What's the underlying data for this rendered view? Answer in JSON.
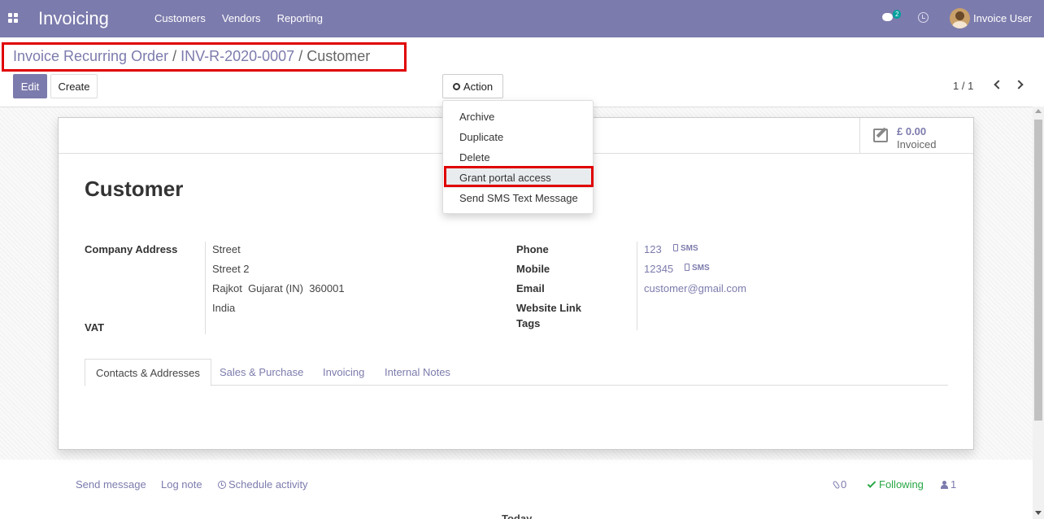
{
  "navbar": {
    "app_title": "Invoicing",
    "menu": [
      "Customers",
      "Vendors",
      "Reporting"
    ],
    "chat_badge": "2",
    "user_name": "Invoice User",
    "bg_color": "#7c7bad"
  },
  "breadcrumb": {
    "items": [
      "Invoice Recurring Order",
      "INV-R-2020-0007"
    ],
    "current": "Customer",
    "separator": "/"
  },
  "toolbar": {
    "edit_label": "Edit",
    "create_label": "Create",
    "action_label": "Action",
    "pager": "1 / 1"
  },
  "action_menu": {
    "items": [
      "Archive",
      "Duplicate",
      "Delete",
      "Grant portal access",
      "Send SMS Text Message"
    ],
    "highlighted": "Grant portal access"
  },
  "stat_button": {
    "value": "£ 0.00",
    "label": "Invoiced"
  },
  "record": {
    "name": "Customer",
    "company_address_label": "Company Address",
    "address_lines": [
      "Street",
      "Street 2",
      "Rajkot  Gujarat (IN)  360001",
      "India"
    ],
    "vat_label": "VAT",
    "phone_label": "Phone",
    "phone": "123",
    "mobile_label": "Mobile",
    "mobile": "12345",
    "sms_label": "SMS",
    "email_label": "Email",
    "email": "customer@gmail.com",
    "website_label": "Website Link",
    "tags_label": "Tags"
  },
  "tabs": [
    "Contacts & Addresses",
    "Sales & Purchase",
    "Invoicing",
    "Internal Notes"
  ],
  "chatter": {
    "send_message": "Send message",
    "log_note": "Log note",
    "schedule_activity": "Schedule activity",
    "attachments": "0",
    "following": "Following",
    "followers": "1",
    "today": "Today"
  },
  "colors": {
    "accent": "#7c7bad",
    "highlight_box": "#e00000",
    "following": "#28a745"
  }
}
